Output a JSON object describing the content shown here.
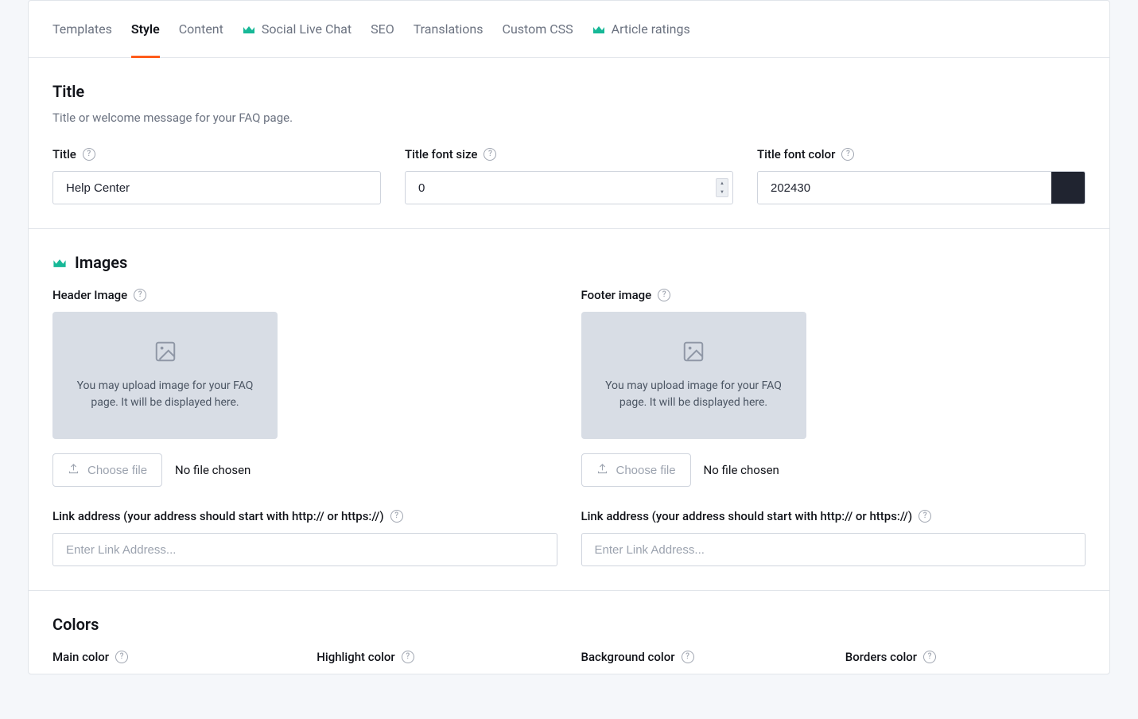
{
  "tabs": {
    "templates": "Templates",
    "style": "Style",
    "content": "Content",
    "social": "Social Live Chat",
    "seo": "SEO",
    "translations": "Translations",
    "custom_css": "Custom CSS",
    "ratings": "Article ratings"
  },
  "title_section": {
    "heading": "Title",
    "desc": "Title or welcome message for your FAQ page.",
    "title_label": "Title",
    "title_value": "Help Center",
    "font_size_label": "Title font size",
    "font_size_value": "0",
    "font_color_label": "Title font color",
    "font_color_value": "202430",
    "font_color_hex": "#202430"
  },
  "images_section": {
    "heading": "Images",
    "header_image_label": "Header Image",
    "footer_image_label": "Footer image",
    "upload_hint": "You may upload image for your FAQ page. It will be displayed here.",
    "choose_file": "Choose file",
    "no_file": "No file chosen",
    "link_label": "Link address (your address should start with http:// or https://)",
    "link_placeholder": "Enter Link Address..."
  },
  "colors_section": {
    "heading": "Colors",
    "main_label": "Main color",
    "highlight_label": "Highlight color",
    "background_label": "Background color",
    "borders_label": "Borders color"
  }
}
